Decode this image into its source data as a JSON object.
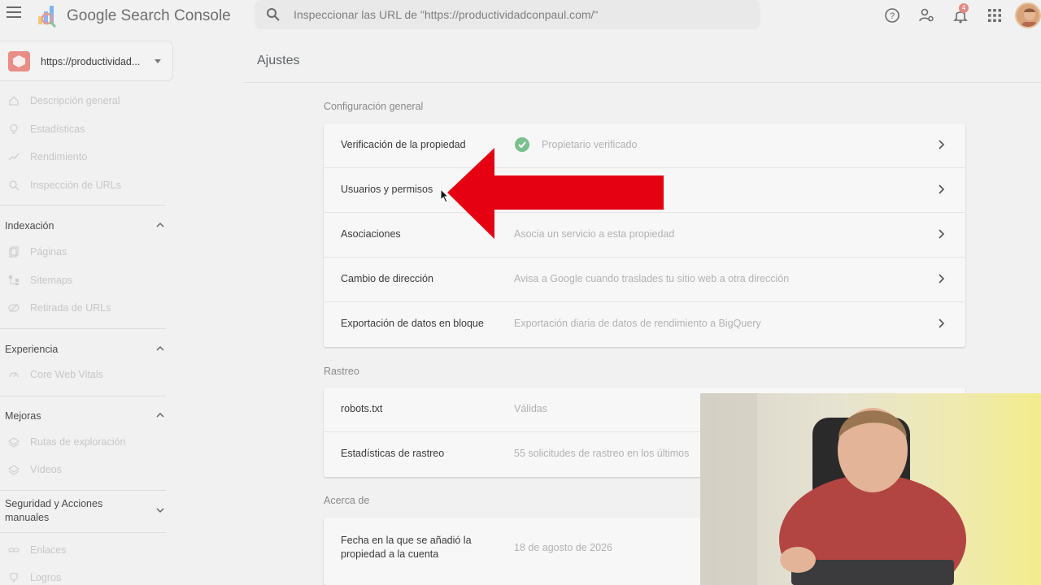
{
  "app": {
    "title": "Google Search Console"
  },
  "search": {
    "placeholder": "Inspeccionar las URL de \"https://productividadconpaul.com/\""
  },
  "notifications": {
    "count": "4"
  },
  "property": {
    "url": "https://productividad..."
  },
  "sidebar": {
    "top_items": [
      {
        "label": "Descripción general",
        "icon": "home-icon"
      },
      {
        "label": "Estadísticas",
        "icon": "lightbulb-icon"
      },
      {
        "label": "Rendimiento",
        "icon": "trending-up-icon"
      },
      {
        "label": "Inspección de URLs",
        "icon": "search-icon"
      }
    ],
    "sections": [
      {
        "label": "Indexación",
        "items": [
          {
            "label": "Páginas",
            "icon": "pages-icon"
          },
          {
            "label": "Sitemaps",
            "icon": "sitemap-icon"
          },
          {
            "label": "Retirada de URLs",
            "icon": "visibility-off-icon"
          }
        ]
      },
      {
        "label": "Experiencia",
        "items": [
          {
            "label": "Core Web Vitals",
            "icon": "speed-icon"
          }
        ]
      },
      {
        "label": "Mejoras",
        "items": [
          {
            "label": "Rutas de exploración",
            "icon": "layers-icon"
          },
          {
            "label": "Vídeos",
            "icon": "layers-icon"
          }
        ]
      },
      {
        "label": "Seguridad y Acciones manuales",
        "items": []
      }
    ],
    "bottom_items": [
      {
        "label": "Enlaces",
        "icon": "link-icon"
      },
      {
        "label": "Logros",
        "icon": "trophy-icon"
      }
    ]
  },
  "main": {
    "title": "Ajustes",
    "general": {
      "title": "Configuración general",
      "rows": [
        {
          "label": "Verificación de la propiedad",
          "value": "Propietario verificado"
        },
        {
          "label": "Usuarios y permisos",
          "value": ""
        },
        {
          "label": "Asociaciones",
          "value": "Asocia un servicio a esta propiedad"
        },
        {
          "label": "Cambio de dirección",
          "value": "Avisa a Google cuando traslades tu sitio web a otra dirección"
        },
        {
          "label": "Exportación de datos en bloque",
          "value": "Exportación diaria de datos de rendimiento a BigQuery"
        }
      ]
    },
    "crawl": {
      "title": "Rastreo",
      "rows": [
        {
          "label": "robots.txt",
          "value": "Válidas"
        },
        {
          "label": "Estadísticas de rastreo",
          "value": "55 solicitudes de rastreo en los últimos"
        }
      ]
    },
    "about": {
      "title": "Acerca de",
      "rows": [
        {
          "label": "Fecha en la que se añadió la propiedad a la cuenta",
          "value": "18 de agosto de 2026"
        }
      ]
    }
  },
  "colors": {
    "arrow": "#e50012",
    "verified": "#79c08e",
    "background": "#f1f1f1"
  }
}
